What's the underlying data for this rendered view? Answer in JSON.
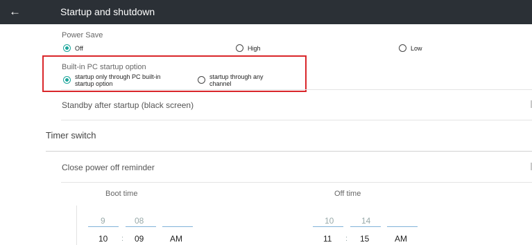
{
  "header": {
    "title": "Startup and shutdown",
    "back_icon": "←"
  },
  "power_save": {
    "label": "Power Save",
    "options": [
      "Off",
      "High",
      "Low"
    ],
    "selected": "Off"
  },
  "builtin_pc": {
    "label": "Built-in PC startup option",
    "option1": [
      "startup only through PC built-in",
      "startup option"
    ],
    "option2": [
      "startup through any",
      "channel"
    ],
    "selected": "option1"
  },
  "standby": {
    "label": "Standby after startup (black screen)"
  },
  "timer": {
    "label": "Timer switch"
  },
  "close_reminder": {
    "label": "Close power off reminder"
  },
  "boot_time": {
    "label": "Boot time",
    "prev_hour": "9",
    "prev_minute": "08",
    "hour": "10",
    "minute": "09",
    "ampm": "AM",
    "separator": ":"
  },
  "off_time": {
    "label": "Off time",
    "prev_hour": "10",
    "prev_minute": "14",
    "hour": "11",
    "minute": "15",
    "ampm": "AM",
    "separator": ":"
  },
  "colors": {
    "accent": "#19a59a",
    "header_bg": "#2b3036",
    "highlight_border": "#d9262a"
  }
}
